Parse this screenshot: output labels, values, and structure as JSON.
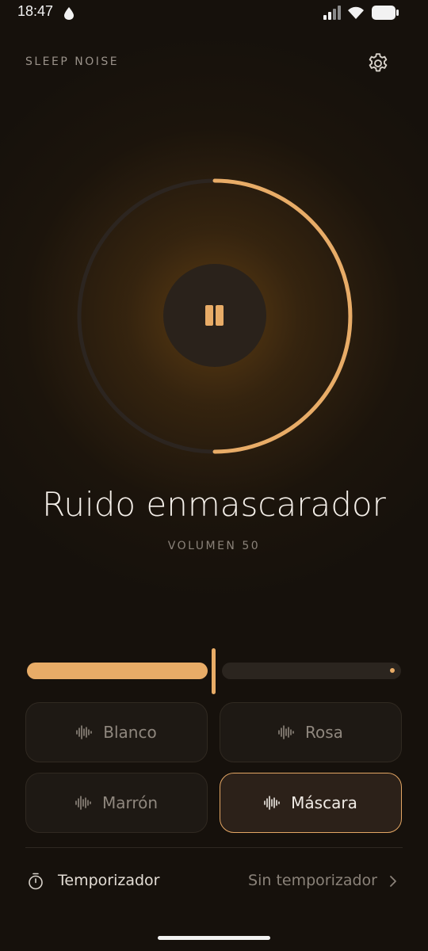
{
  "status_bar": {
    "time": "18:47"
  },
  "header": {
    "app_title": "SLEEP NOISE"
  },
  "player": {
    "title": "Ruido enmascarador",
    "volume_label": "VOLUMEN",
    "volume_value": "50",
    "volume_fraction": 0.5,
    "state": "playing"
  },
  "noise_types": [
    {
      "label": "Blanco",
      "active": false
    },
    {
      "label": "Rosa",
      "active": false
    },
    {
      "label": "Marrón",
      "active": false
    },
    {
      "label": "Máscara",
      "active": true
    }
  ],
  "timer": {
    "label": "Temporizador",
    "value": "Sin temporizador"
  },
  "colors": {
    "accent": "#e8ac67",
    "background": "#16110c",
    "button_bg": "#1e1914",
    "active_border": "#e3a664"
  },
  "icons": {
    "status_drop": "drop-icon",
    "signal": "signal-icon",
    "wifi": "wifi-icon",
    "battery": "battery-icon",
    "settings": "gear-icon",
    "play_pause": "pause-icon",
    "noise": "waveform-icon",
    "timer": "stopwatch-icon",
    "chevron": "chevron-right-icon"
  }
}
